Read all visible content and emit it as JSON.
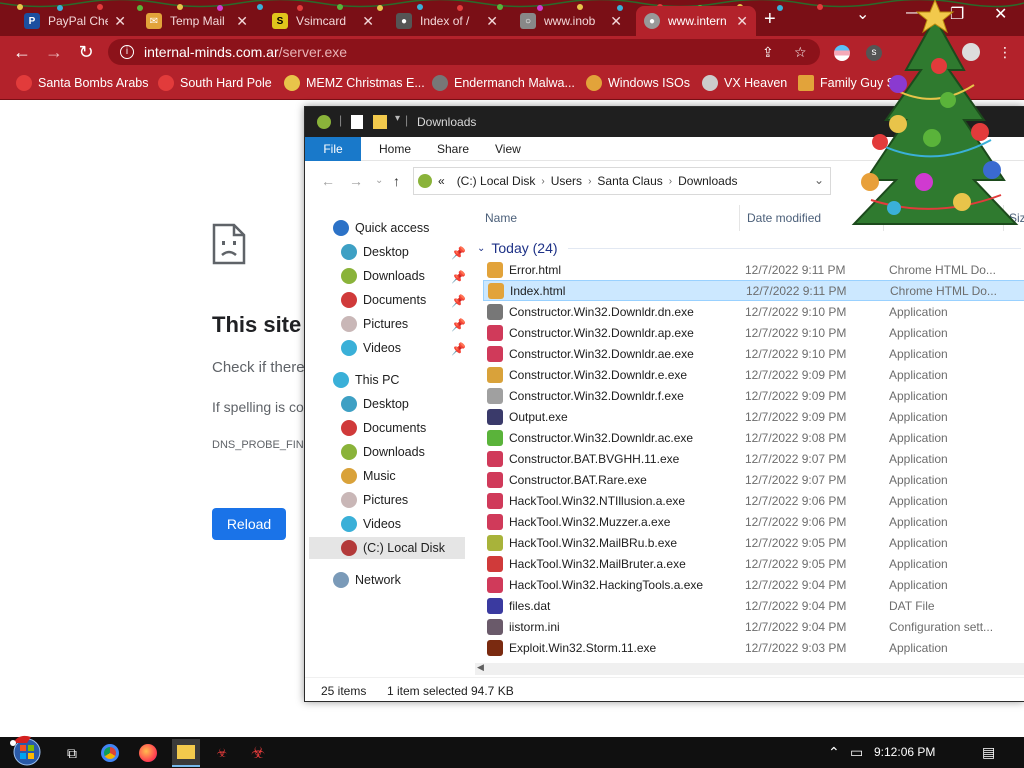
{
  "browser": {
    "tabs": [
      {
        "title": "PayPal Che",
        "color": "#1c4fa0",
        "active": false
      },
      {
        "title": "Temp Mail",
        "color": "#e2a33a",
        "active": false
      },
      {
        "title": "Vsimcard",
        "color": "#e0c51c",
        "active": false
      },
      {
        "title": "Index of /",
        "color": "#555555",
        "active": false
      },
      {
        "title": "www.inob",
        "color": "#888888",
        "active": false
      },
      {
        "title": "www.intern",
        "color": "#999999",
        "active": true
      }
    ],
    "address": {
      "host": "internal-minds.com.ar",
      "path": "/server.exe"
    },
    "bookmarks": [
      {
        "label": "Santa Bombs Arabs",
        "color": "#e23b3b"
      },
      {
        "label": "South Hard Pole",
        "color": "#e23b3b"
      },
      {
        "label": "MEMZ Christmas E...",
        "color": "#e8c44a"
      },
      {
        "label": "Endermanch Malwa...",
        "color": "#777777"
      },
      {
        "label": "Windows ISOs",
        "color": "#e2a33a"
      },
      {
        "label": "VX Heaven",
        "color": "#cccccc"
      },
      {
        "label": "Family Guy S",
        "color": "#e2a33a"
      }
    ]
  },
  "error_page": {
    "title": "This site",
    "check": "Check if there",
    "spell": "If spelling is co",
    "code": "DNS_PROBE_FINI",
    "reload": "Reload"
  },
  "explorer": {
    "title": "Downloads",
    "ribbon": [
      "File",
      "Home",
      "Share",
      "View"
    ],
    "breadcrumb": [
      "(C:) Local Disk",
      "Users",
      "Santa Claus",
      "Downloads"
    ],
    "nav": [
      {
        "label": "Quick access",
        "color": "#2c72c7",
        "indent": 0,
        "pinned": false,
        "selected": false
      },
      {
        "label": "Desktop",
        "color": "#3ea0c4",
        "indent": 1,
        "pinned": true,
        "selected": false
      },
      {
        "label": "Downloads",
        "color": "#8ab33a",
        "indent": 1,
        "pinned": true,
        "selected": false
      },
      {
        "label": "Documents",
        "color": "#d03a3a",
        "indent": 1,
        "pinned": true,
        "selected": false
      },
      {
        "label": "Pictures",
        "color": "#c9b7b7",
        "indent": 1,
        "pinned": true,
        "selected": false
      },
      {
        "label": "Videos",
        "color": "#3ab0d8",
        "indent": 1,
        "pinned": true,
        "selected": false
      },
      {
        "label": "This PC",
        "color": "#3ab0d8",
        "indent": 0,
        "pinned": false,
        "selected": false
      },
      {
        "label": "Desktop",
        "color": "#3ea0c4",
        "indent": 1,
        "pinned": false,
        "selected": false
      },
      {
        "label": "Documents",
        "color": "#d03a3a",
        "indent": 1,
        "pinned": false,
        "selected": false
      },
      {
        "label": "Downloads",
        "color": "#8ab33a",
        "indent": 1,
        "pinned": false,
        "selected": false
      },
      {
        "label": "Music",
        "color": "#d9a23a",
        "indent": 1,
        "pinned": false,
        "selected": false
      },
      {
        "label": "Pictures",
        "color": "#c9b7b7",
        "indent": 1,
        "pinned": false,
        "selected": false
      },
      {
        "label": "Videos",
        "color": "#3ab0d8",
        "indent": 1,
        "pinned": false,
        "selected": false
      },
      {
        "label": "(C:) Local Disk",
        "color": "#b33a3a",
        "indent": 1,
        "pinned": false,
        "selected": true
      },
      {
        "label": "Network",
        "color": "#7a9ab8",
        "indent": 0,
        "pinned": false,
        "selected": false
      }
    ],
    "columns": {
      "name": "Name",
      "date": "Date modified",
      "type": "Type",
      "size": "Siz"
    },
    "group": "Today (24)",
    "files": [
      {
        "name": "Error.html",
        "date": "12/7/2022 9:11 PM",
        "type": "Chrome HTML Do...",
        "color": "#e2a33a",
        "selected": false
      },
      {
        "name": "Index.html",
        "date": "12/7/2022 9:11 PM",
        "type": "Chrome HTML Do...",
        "color": "#e2a33a",
        "selected": true
      },
      {
        "name": "Constructor.Win32.Downldr.dn.exe",
        "date": "12/7/2022 9:10 PM",
        "type": "Application",
        "color": "#777777",
        "selected": false
      },
      {
        "name": "Constructor.Win32.Downldr.ap.exe",
        "date": "12/7/2022 9:10 PM",
        "type": "Application",
        "color": "#d03a5a",
        "selected": false
      },
      {
        "name": "Constructor.Win32.Downldr.ae.exe",
        "date": "12/7/2022 9:10 PM",
        "type": "Application",
        "color": "#d03a5a",
        "selected": false
      },
      {
        "name": "Constructor.Win32.Downldr.e.exe",
        "date": "12/7/2022 9:09 PM",
        "type": "Application",
        "color": "#d9a23a",
        "selected": false
      },
      {
        "name": "Constructor.Win32.Downldr.f.exe",
        "date": "12/7/2022 9:09 PM",
        "type": "Application",
        "color": "#a0a0a0",
        "selected": false
      },
      {
        "name": "Output.exe",
        "date": "12/7/2022 9:09 PM",
        "type": "Application",
        "color": "#3a3a6a",
        "selected": false
      },
      {
        "name": "Constructor.Win32.Downldr.ac.exe",
        "date": "12/7/2022 9:08 PM",
        "type": "Application",
        "color": "#5ab33a",
        "selected": false
      },
      {
        "name": "Constructor.BAT.BVGHH.11.exe",
        "date": "12/7/2022 9:07 PM",
        "type": "Application",
        "color": "#d03a5a",
        "selected": false
      },
      {
        "name": "Constructor.BAT.Rare.exe",
        "date": "12/7/2022 9:07 PM",
        "type": "Application",
        "color": "#d03a5a",
        "selected": false
      },
      {
        "name": "HackTool.Win32.NTIllusion.a.exe",
        "date": "12/7/2022 9:06 PM",
        "type": "Application",
        "color": "#d03a5a",
        "selected": false
      },
      {
        "name": "HackTool.Win32.Muzzer.a.exe",
        "date": "12/7/2022 9:06 PM",
        "type": "Application",
        "color": "#d03a5a",
        "selected": false
      },
      {
        "name": "HackTool.Win32.MailBRu.b.exe",
        "date": "12/7/2022 9:05 PM",
        "type": "Application",
        "color": "#a8b33a",
        "selected": false
      },
      {
        "name": "HackTool.Win32.MailBruter.a.exe",
        "date": "12/7/2022 9:05 PM",
        "type": "Application",
        "color": "#d03a3a",
        "selected": false
      },
      {
        "name": "HackTool.Win32.HackingTools.a.exe",
        "date": "12/7/2022 9:04 PM",
        "type": "Application",
        "color": "#d03a5a",
        "selected": false
      },
      {
        "name": "files.dat",
        "date": "12/7/2022 9:04 PM",
        "type": "DAT File",
        "color": "#3a3aa0",
        "selected": false
      },
      {
        "name": "iistorm.ini",
        "date": "12/7/2022 9:04 PM",
        "type": "Configuration sett...",
        "color": "#6a5a6a",
        "selected": false
      },
      {
        "name": "Exploit.Win32.Storm.11.exe",
        "date": "12/7/2022 9:03 PM",
        "type": "Application",
        "color": "#7a2a10",
        "selected": false
      }
    ],
    "status": {
      "count": "25 items",
      "selected": "1 item selected",
      "size": "94.7 KB"
    }
  },
  "taskbar": {
    "clock": "9:12:06 PM"
  }
}
